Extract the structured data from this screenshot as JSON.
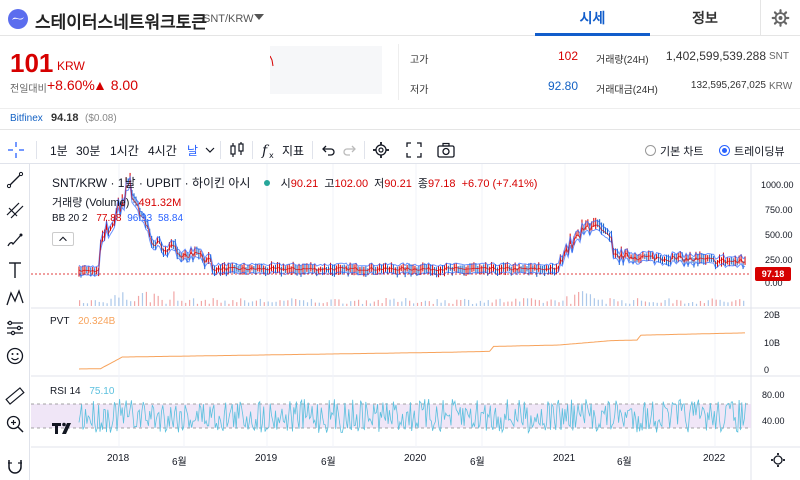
{
  "header": {
    "coin_name": "스테이터스네트워크토큰",
    "pair": "SNT/KRW",
    "tabs": [
      {
        "label": "시세"
      },
      {
        "label": "정보"
      }
    ]
  },
  "summary": {
    "price": "101",
    "unit": "KRW",
    "change_label": "전일대비",
    "change_pct": "+8.60%",
    "change_amt": "▲ 8.00",
    "high_label": "고가",
    "high": "102",
    "low_label": "저가",
    "low": "92.80",
    "volume_label": "거래량(24H)",
    "volume": "1,402,599,539.288",
    "volume_unit": "SNT",
    "turnover_label": "거래대금(24H)",
    "turnover": "132,595,267,025",
    "turnover_unit": "KRW"
  },
  "bitfinex": {
    "name": "Bitfinex",
    "price": "94.18",
    "diff": "($0.08)"
  },
  "toolbar": {
    "intervals": [
      "1분",
      "30분",
      "1시간",
      "4시간",
      "날"
    ],
    "indicator_label": "지표",
    "basic_chart": "기본 차트",
    "tradingview": "트레이딩뷰"
  },
  "legend": {
    "symbol": "SNT/KRW · 1날 · UPBIT · 하이킨 아시",
    "o_lbl": "시",
    "o": "90.21",
    "h_lbl": "고",
    "h": "102.00",
    "l_lbl": "저",
    "l": "90.21",
    "c_lbl": "종",
    "c": "97.18",
    "chg": "+6.70 (+7.41%)",
    "volume_label": "거래량 (Volume)",
    "volume_value": "491.32M",
    "bb_label": "BB 20 2",
    "bb_mid": "77.88",
    "bb_up": "96.93",
    "bb_low": "58.84",
    "pvt_label": "PVT",
    "pvt_value": "20.324B",
    "rsi_label": "RSI 14",
    "rsi_value": "75.10"
  },
  "price_axis": [
    "1000.00",
    "750.00",
    "500.00",
    "250.00",
    "0.00"
  ],
  "last_price_tag": "97.18",
  "pvt_axis": [
    "20B",
    "10B",
    "0"
  ],
  "rsi_axis": [
    "80.00",
    "40.00"
  ],
  "time_axis": [
    "2018",
    "6월",
    "2019",
    "6월",
    "2020",
    "6월",
    "2021",
    "6월",
    "2022"
  ],
  "colors": {
    "up": "#d60000",
    "down": "#1261c4",
    "accent": "#115dcb",
    "pvt": "#f7a35c",
    "rsi": "#5bc0de",
    "bb": "#2962ff"
  }
}
